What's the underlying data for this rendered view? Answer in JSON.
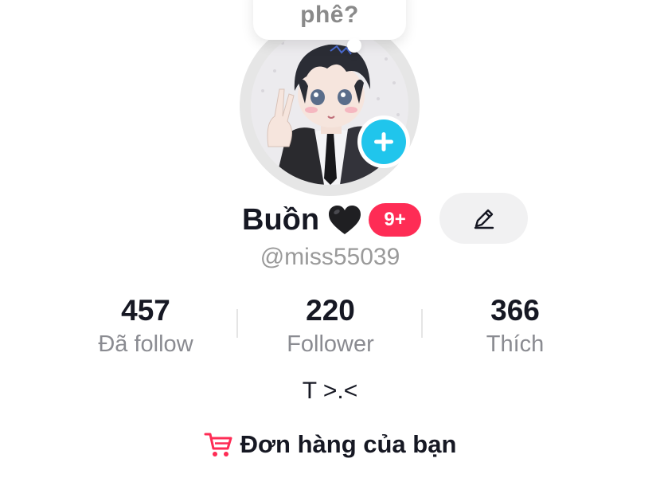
{
  "note": {
    "text": "phê?"
  },
  "profile": {
    "display_name": "Buồn",
    "notification_badge": "9+",
    "username": "@miss55039",
    "bio": "T >.<"
  },
  "stats": [
    {
      "value": "457",
      "label": "Đã follow"
    },
    {
      "value": "220",
      "label": "Follower"
    },
    {
      "value": "366",
      "label": "Thích"
    }
  ],
  "orders": {
    "label": "Đơn hàng của bạn"
  },
  "icons": {
    "heart": "black-heart-icon",
    "edit": "pencil-icon",
    "add": "plus-icon",
    "cart": "shopping-cart-icon"
  },
  "colors": {
    "badge": "#fe2c55",
    "add_button": "#20c5ec",
    "cart": "#fe2c55"
  }
}
